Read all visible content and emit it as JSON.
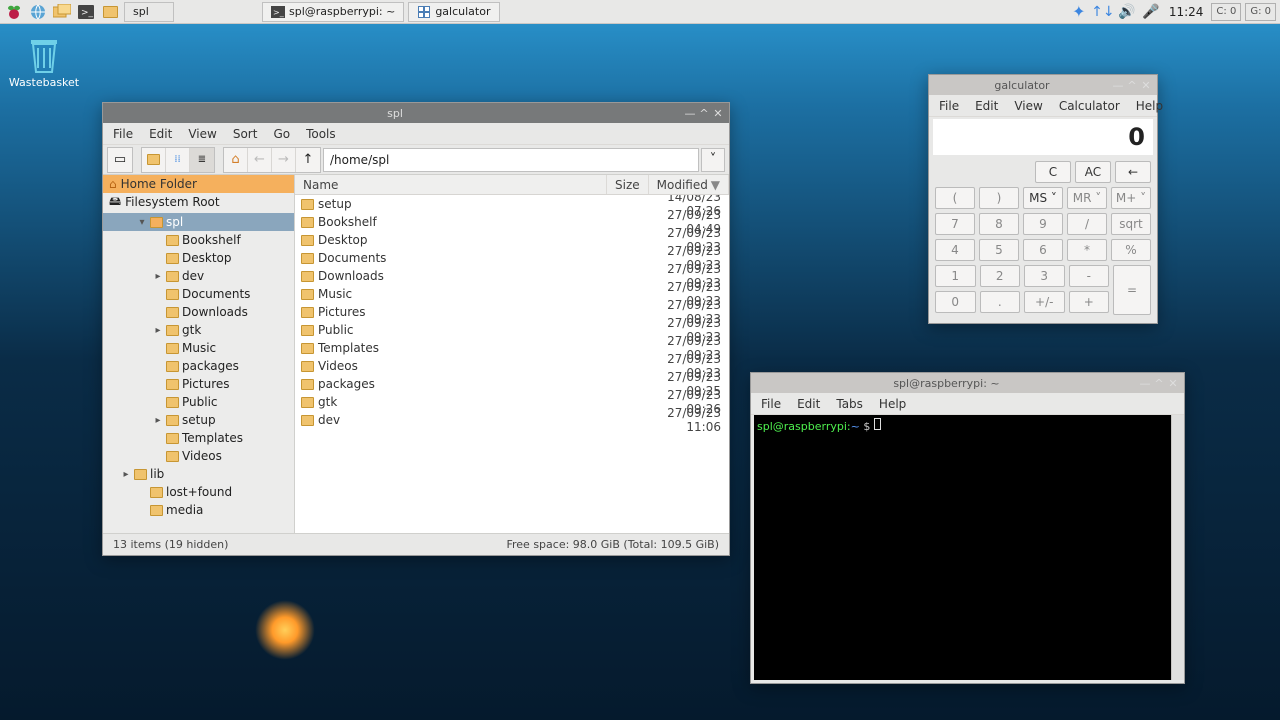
{
  "taskbar": {
    "apps": [
      {
        "name": "menu-raspberry",
        "icon": "raspberry"
      },
      {
        "name": "web-browser",
        "icon": "globe"
      },
      {
        "name": "file-manager-launcher",
        "icon": "folders"
      },
      {
        "name": "terminal-launcher",
        "icon": "term"
      }
    ],
    "tasks": [
      {
        "name": "task-filemanager",
        "icon": "folder",
        "label": "spl"
      },
      {
        "name": "task-terminal",
        "icon": "term",
        "label": "spl@raspberrypi: ~"
      },
      {
        "name": "task-galculator",
        "icon": "calc",
        "label": "galculator"
      }
    ],
    "tray": {
      "bluetooth": "bluetooth-icon",
      "network": "network-icon",
      "volume": "volume-icon",
      "mic": "mic-icon",
      "clock": "11:24",
      "ws1": "C: 0",
      "ws2": "G: 0"
    }
  },
  "desktop": {
    "trash_label": "Wastebasket"
  },
  "filemanager": {
    "title": "spl",
    "menus": [
      "File",
      "Edit",
      "View",
      "Sort",
      "Go",
      "Tools"
    ],
    "path": "/home/spl",
    "places": {
      "home": "Home Folder",
      "root": "Filesystem Root"
    },
    "tree": [
      {
        "d": 1,
        "label": "spl",
        "exp": "▾",
        "sel": true,
        "icon": "home"
      },
      {
        "d": 2,
        "label": "Bookshelf",
        "icon": "folder"
      },
      {
        "d": 2,
        "label": "Desktop",
        "icon": "desktop"
      },
      {
        "d": 2,
        "label": "dev",
        "exp": "▸",
        "icon": "folder"
      },
      {
        "d": 2,
        "label": "Documents",
        "icon": "folder"
      },
      {
        "d": 2,
        "label": "Downloads",
        "icon": "folder"
      },
      {
        "d": 2,
        "label": "gtk",
        "exp": "▸",
        "icon": "folder"
      },
      {
        "d": 2,
        "label": "Music",
        "icon": "music"
      },
      {
        "d": 2,
        "label": "packages",
        "icon": "folder"
      },
      {
        "d": 2,
        "label": "Pictures",
        "icon": "pictures"
      },
      {
        "d": 2,
        "label": "Public",
        "icon": "folder"
      },
      {
        "d": 2,
        "label": "setup",
        "exp": "▸",
        "icon": "folder"
      },
      {
        "d": 2,
        "label": "Templates",
        "icon": "folder"
      },
      {
        "d": 2,
        "label": "Videos",
        "icon": "folder"
      },
      {
        "d": 0,
        "label": "lib",
        "exp": "▸",
        "icon": "folder"
      },
      {
        "d": 1,
        "label": "lost+found",
        "icon": "folder"
      },
      {
        "d": 1,
        "label": "media",
        "icon": "folder"
      }
    ],
    "cols": {
      "name": "Name",
      "size": "Size",
      "modified": "Modified"
    },
    "rows": [
      {
        "name": "setup",
        "mod": "14/08/23 07:26"
      },
      {
        "name": "Bookshelf",
        "mod": "27/09/23 04:49"
      },
      {
        "name": "Desktop",
        "mod": "27/09/23 09:23"
      },
      {
        "name": "Documents",
        "mod": "27/09/23 09:23"
      },
      {
        "name": "Downloads",
        "mod": "27/09/23 09:23"
      },
      {
        "name": "Music",
        "mod": "27/09/23 09:23"
      },
      {
        "name": "Pictures",
        "mod": "27/09/23 09:23"
      },
      {
        "name": "Public",
        "mod": "27/09/23 09:23"
      },
      {
        "name": "Templates",
        "mod": "27/09/23 09:23"
      },
      {
        "name": "Videos",
        "mod": "27/09/23 09:23"
      },
      {
        "name": "packages",
        "mod": "27/09/23 09:25"
      },
      {
        "name": "gtk",
        "mod": "27/09/23 09:26"
      },
      {
        "name": "dev",
        "mod": "27/09/23 11:06"
      }
    ],
    "status_left": "13 items (19 hidden)",
    "status_right": "Free space: 98.0 GiB (Total: 109.5 GiB)"
  },
  "calculator": {
    "title": "galculator",
    "menus": [
      "File",
      "Edit",
      "View",
      "Calculator",
      "Help"
    ],
    "display": "0",
    "row0": [
      "C",
      "AC",
      "←"
    ],
    "row1": [
      "(",
      ")",
      "MS ˅",
      "MR ˅",
      "M+ ˅"
    ],
    "row2": [
      "7",
      "8",
      "9",
      "/",
      "sqrt"
    ],
    "row3": [
      "4",
      "5",
      "6",
      "*",
      "%"
    ],
    "row4": [
      "1",
      "2",
      "3",
      "-"
    ],
    "row5": [
      "0",
      ".",
      "+/-",
      "+"
    ],
    "eq": "="
  },
  "terminal": {
    "title": "spl@raspberrypi: ~",
    "menus": [
      "File",
      "Edit",
      "Tabs",
      "Help"
    ],
    "prompt_user": "spl@raspberrypi",
    "prompt_colon": ":",
    "prompt_path": "~",
    "prompt_dollar": " $ "
  }
}
